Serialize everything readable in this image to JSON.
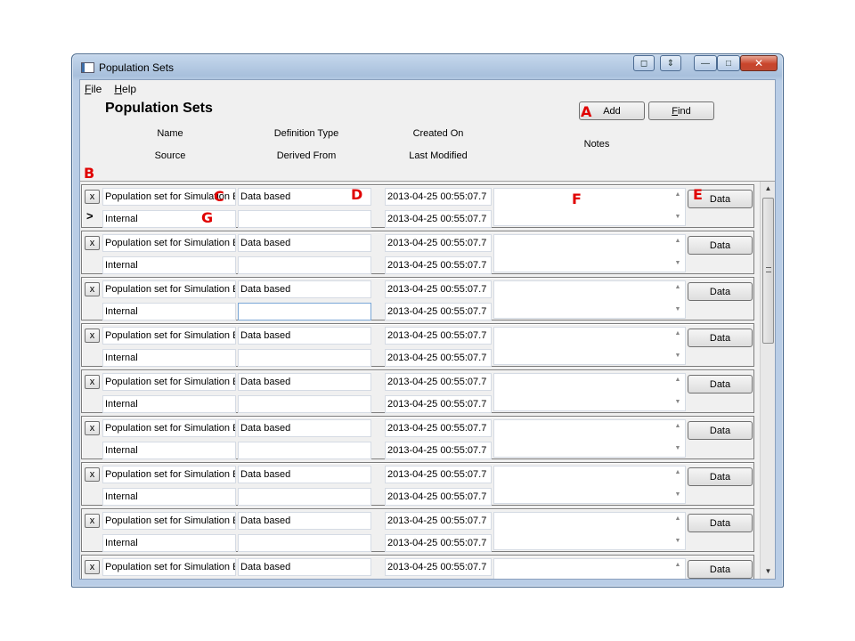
{
  "window": {
    "title": "Population Sets",
    "caption_buttons": [
      "◻",
      "⇕",
      "—",
      "□",
      "✕"
    ]
  },
  "menu": {
    "file_u": "F",
    "file_rest": "ile",
    "help_u": "H",
    "help_rest": "elp"
  },
  "header": {
    "title": "Population Sets",
    "add_label": "Add",
    "find_u": "F",
    "find_rest": "ind",
    "columns": {
      "name": "Name",
      "source": "Source",
      "definition_type": "Definition Type",
      "derived_from": "Derived From",
      "created_on": "Created On",
      "last_modified": "Last Modified",
      "notes": "Notes"
    }
  },
  "markers": {
    "a": "A",
    "b": "B",
    "c": "C",
    "d": "D",
    "e": "E",
    "f": "F",
    "g": "G"
  },
  "row_common": {
    "delete_label": "x",
    "data_label": "Data",
    "current_indicator": ">"
  },
  "rows": [
    {
      "name": "Population set for Simulation E",
      "definition_type": "Data based",
      "source": "Internal",
      "derived_from": "",
      "created_on": "2013-04-25 00:55:07.7",
      "last_modified": "2013-04-25 00:55:07.7",
      "notes": ""
    },
    {
      "name": "Population set for Simulation E",
      "definition_type": "Data based",
      "source": "Internal",
      "derived_from": "",
      "created_on": "2013-04-25 00:55:07.7",
      "last_modified": "2013-04-25 00:55:07.7",
      "notes": ""
    },
    {
      "name": "Population set for Simulation E",
      "definition_type": "Data based",
      "source": "Internal",
      "derived_from": "",
      "created_on": "2013-04-25 00:55:07.7",
      "last_modified": "2013-04-25 00:55:07.7",
      "notes": ""
    },
    {
      "name": "Population set for Simulation E",
      "definition_type": "Data based",
      "source": "Internal",
      "derived_from": "",
      "created_on": "2013-04-25 00:55:07.7",
      "last_modified": "2013-04-25 00:55:07.7",
      "notes": ""
    },
    {
      "name": "Population set for Simulation E",
      "definition_type": "Data based",
      "source": "Internal",
      "derived_from": "",
      "created_on": "2013-04-25 00:55:07.7",
      "last_modified": "2013-04-25 00:55:07.7",
      "notes": ""
    },
    {
      "name": "Population set for Simulation E",
      "definition_type": "Data based",
      "source": "Internal",
      "derived_from": "",
      "created_on": "2013-04-25 00:55:07.7",
      "last_modified": "2013-04-25 00:55:07.7",
      "notes": ""
    },
    {
      "name": "Population set for Simulation E",
      "definition_type": "Data based",
      "source": "Internal",
      "derived_from": "",
      "created_on": "2013-04-25 00:55:07.7",
      "last_modified": "2013-04-25 00:55:07.7",
      "notes": ""
    },
    {
      "name": "Population set for Simulation E",
      "definition_type": "Data based",
      "source": "Internal",
      "derived_from": "",
      "created_on": "2013-04-25 00:55:07.7",
      "last_modified": "2013-04-25 00:55:07.7",
      "notes": ""
    },
    {
      "name": "Population set for Simulation E",
      "definition_type": "Data based",
      "source": "",
      "derived_from": "",
      "created_on": "2013-04-25 00:55:07.7",
      "last_modified": "",
      "notes": ""
    }
  ]
}
